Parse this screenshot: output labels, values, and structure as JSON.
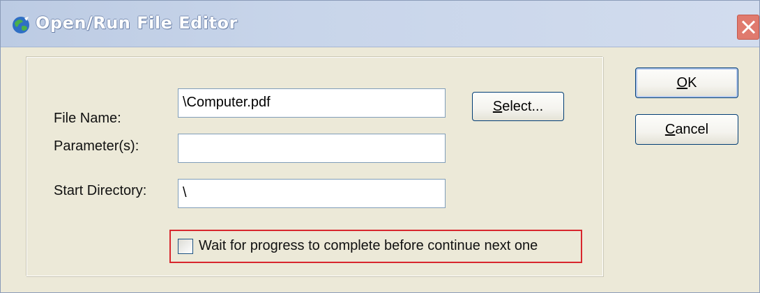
{
  "window": {
    "title": "Open/Run File Editor",
    "icon": "app-globe-icon",
    "close_icon": "close-icon"
  },
  "form": {
    "file_name": {
      "label": "File Name:",
      "value": "\\Computer.pdf"
    },
    "parameters": {
      "label": "Parameter(s):",
      "value": ""
    },
    "start_directory": {
      "label": "Start Directory:",
      "value": "\\"
    },
    "select_button": {
      "label_mnemonic": "S",
      "label_rest": "elect..."
    },
    "wait_checkbox": {
      "label": "Wait for progress to complete before continue next one",
      "checked": false
    }
  },
  "buttons": {
    "ok": {
      "mnemonic": "O",
      "rest": "K"
    },
    "cancel": {
      "mnemonic": "C",
      "rest": "ancel"
    }
  },
  "colors": {
    "dialog_bg": "#ece9d8",
    "titlebar": "#c8d5ea",
    "close_button": "#e07a6e",
    "highlight_border": "#d8262d",
    "button_border": "#003c74"
  }
}
